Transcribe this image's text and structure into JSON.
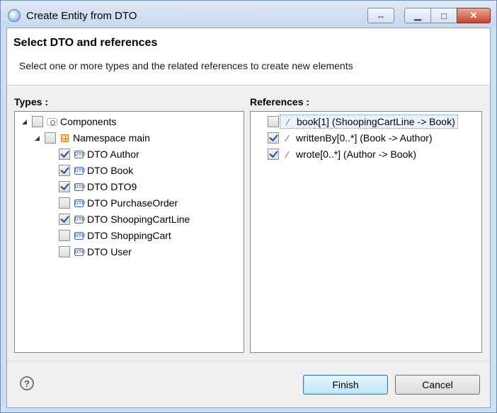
{
  "window": {
    "title": "Create Entity from DTO",
    "buttons": {
      "restore_size": "⇔",
      "minimize": "▁",
      "maximize": "□",
      "close": "✕"
    }
  },
  "header": {
    "title": "Select DTO and references",
    "description": "Select one or more types and the related references to create new elements"
  },
  "types": {
    "label": "Types :",
    "tree": [
      {
        "label": "Components",
        "checked": false,
        "expanded": true,
        "icon": "component-icon"
      },
      {
        "label": "Namespace main",
        "checked": false,
        "expanded": true,
        "icon": "namespace-icon"
      },
      {
        "label": "DTO Author",
        "checked": true,
        "icon": "dto-icon"
      },
      {
        "label": "DTO Book",
        "checked": true,
        "icon": "dto-icon"
      },
      {
        "label": "DTO DTO9",
        "checked": true,
        "icon": "dto-icon"
      },
      {
        "label": "DTO PurchaseOrder",
        "checked": false,
        "icon": "dto-icon"
      },
      {
        "label": "DTO ShoopingCartLine",
        "checked": true,
        "icon": "dto-icon"
      },
      {
        "label": "DTO ShoppingCart",
        "checked": false,
        "icon": "dto-icon"
      },
      {
        "label": "DTO User",
        "checked": false,
        "icon": "dto-icon"
      }
    ]
  },
  "references": {
    "label": "References :",
    "items": [
      {
        "label": "book[1] (ShoopingCartLine -> Book)",
        "checked": false,
        "selected": true,
        "icon": "reference-icon"
      },
      {
        "label": "writtenBy[0..*] (Book -> Author)",
        "checked": true,
        "icon": "reference-icon"
      },
      {
        "label": "wrote[0..*] (Author -> Book)",
        "checked": true,
        "icon": "reference-icon"
      }
    ]
  },
  "footer": {
    "help": "?",
    "finish": "Finish",
    "cancel": "Cancel"
  }
}
